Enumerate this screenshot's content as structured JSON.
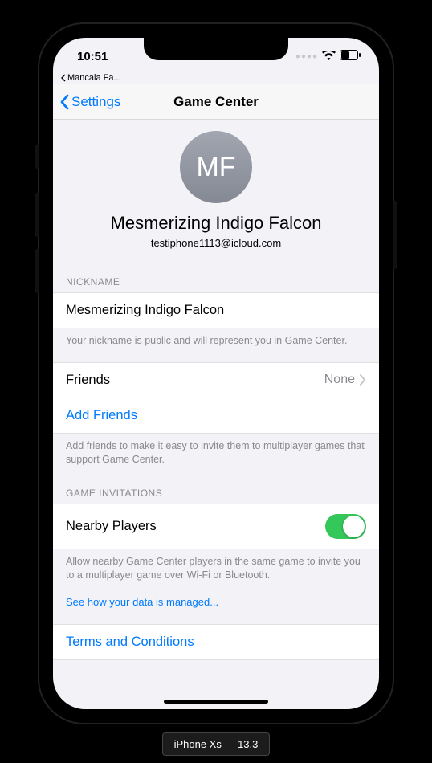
{
  "status": {
    "time": "10:51",
    "breadcrumb": "Mancala Fa..."
  },
  "nav": {
    "back_label": "Settings",
    "title": "Game Center"
  },
  "profile": {
    "initials": "MF",
    "name": "Mesmerizing Indigo Falcon",
    "email": "testiphone1113@icloud.com"
  },
  "nickname": {
    "header": "NICKNAME",
    "value": "Mesmerizing Indigo Falcon",
    "footer": "Your nickname is public and will represent you in Game Center."
  },
  "friends": {
    "label": "Friends",
    "value": "None",
    "add_label": "Add Friends",
    "footer": "Add friends to make it easy to invite them to multiplayer games that support Game Center."
  },
  "invitations": {
    "header": "GAME INVITATIONS",
    "nearby_label": "Nearby Players",
    "nearby_on": true,
    "footer": "Allow nearby Game Center players in the same game to invite you to a multiplayer game over Wi-Fi or Bluetooth.",
    "data_link": "See how your data is managed..."
  },
  "terms": {
    "label": "Terms and Conditions"
  },
  "device_label": "iPhone Xs — 13.3"
}
